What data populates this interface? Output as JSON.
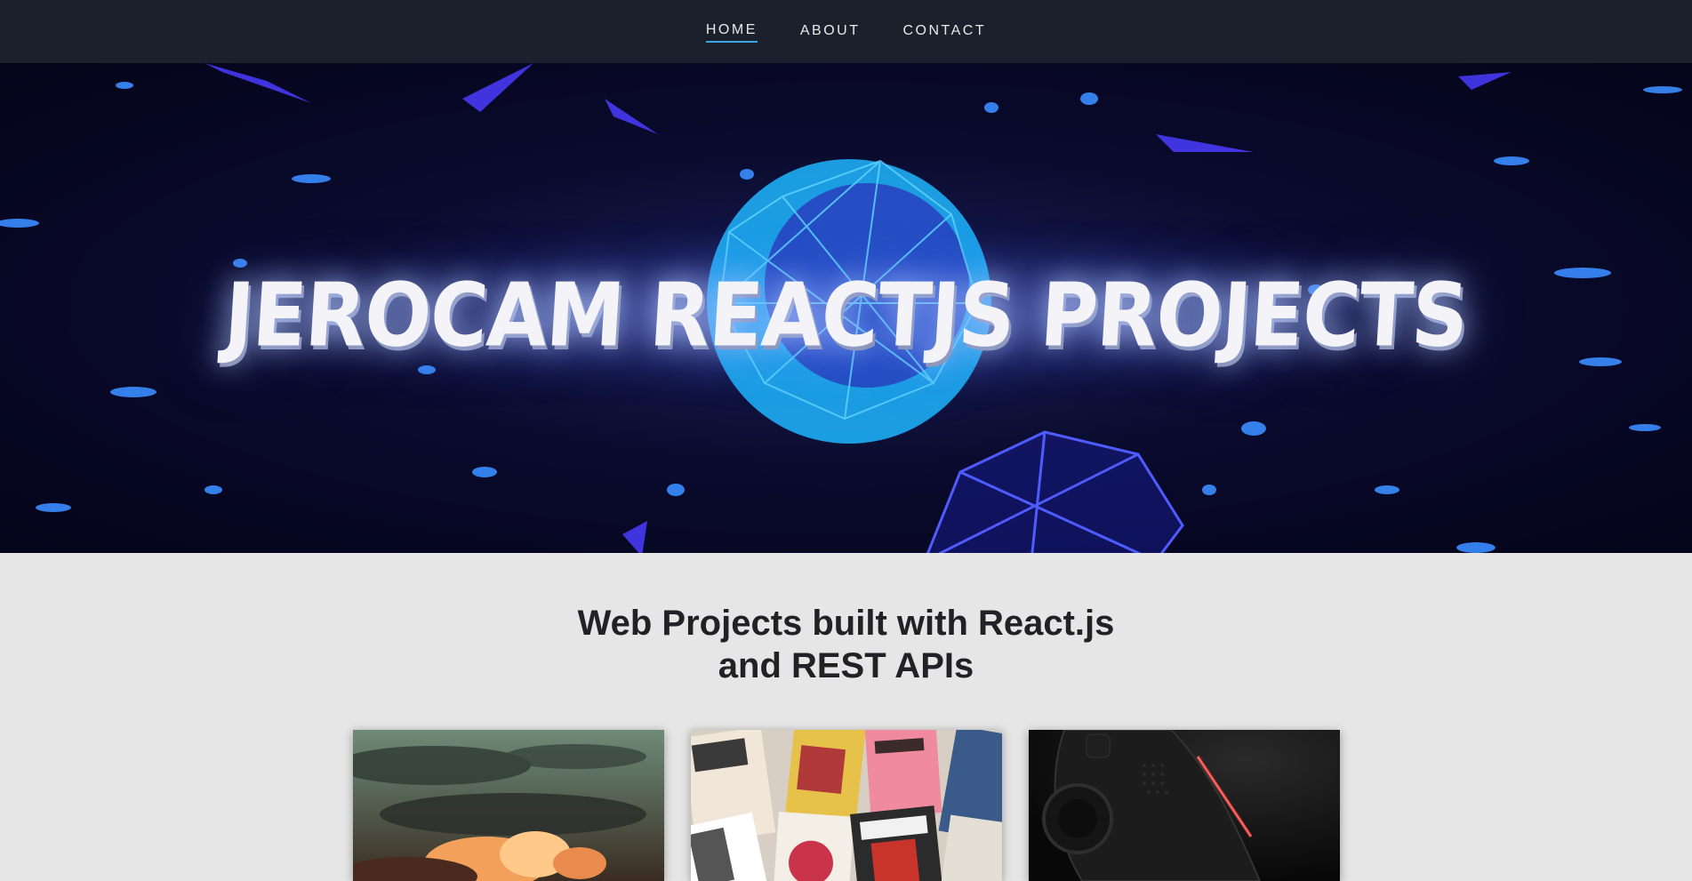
{
  "navbar": {
    "links": [
      {
        "label": "HOME",
        "active": true
      },
      {
        "label": "ABOUT",
        "active": false
      },
      {
        "label": "CONTACT",
        "active": false
      }
    ],
    "accent_color": "#3aa5e8",
    "background": "#1b212c"
  },
  "hero": {
    "title": "JEROCAM REACTJS PROJECTS",
    "background": "#0a0b2e"
  },
  "main": {
    "heading_line1": "Web Projects built with React.js",
    "heading_line2": "and REST APIs",
    "cards": [
      {
        "image": "sunset-clouds-image"
      },
      {
        "image": "manga-covers-collage-image"
      },
      {
        "image": "game-controller-image"
      }
    ]
  }
}
